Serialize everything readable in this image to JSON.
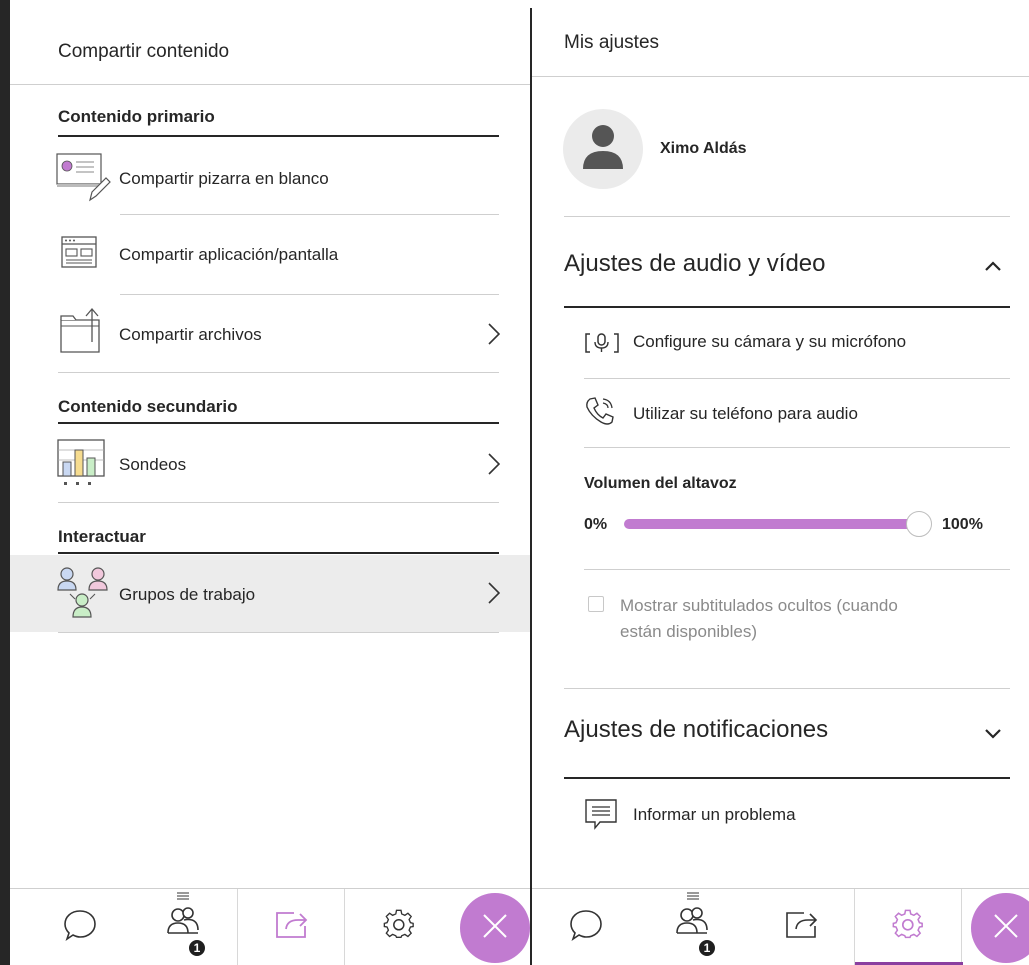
{
  "share_panel": {
    "title": "Compartir contenido",
    "sections": {
      "primary": "Contenido primario",
      "secondary": "Contenido secundario",
      "interact": "Interactuar"
    },
    "items": {
      "whiteboard": "Compartir pizarra en blanco",
      "app_screen": "Compartir aplicación/pantalla",
      "files": "Compartir archivos",
      "polls": "Sondeos",
      "breakout": "Grupos de trabajo"
    }
  },
  "settings_panel": {
    "title": "Mis ajustes",
    "user_name": "Ximo Aldás",
    "audio_video": {
      "title": "Ajustes de audio y vídeo",
      "expanded": true,
      "camera_mic": "Configure su cámara y su micrófono",
      "phone_audio": "Utilizar su teléfono para audio",
      "volume_label": "Volumen del altavoz",
      "volume_min": "0%",
      "volume_max": "100%",
      "volume_value": 1.0,
      "captions_line1": "Mostrar subtitulados ocultos (cuando",
      "captions_line2": "están disponibles)",
      "captions_checked": false
    },
    "notifications": {
      "title": "Ajustes de notificaciones",
      "expanded": false
    },
    "report_problem": "Informar un problema"
  },
  "nav": {
    "attendees_badge": "1",
    "left_active": "share",
    "right_active": "settings"
  },
  "colors": {
    "accent": "#c17bd0",
    "accent_dark": "#8a3fa0",
    "text": "#262626",
    "divider": "#cfcfcf",
    "hover": "#ececec"
  }
}
